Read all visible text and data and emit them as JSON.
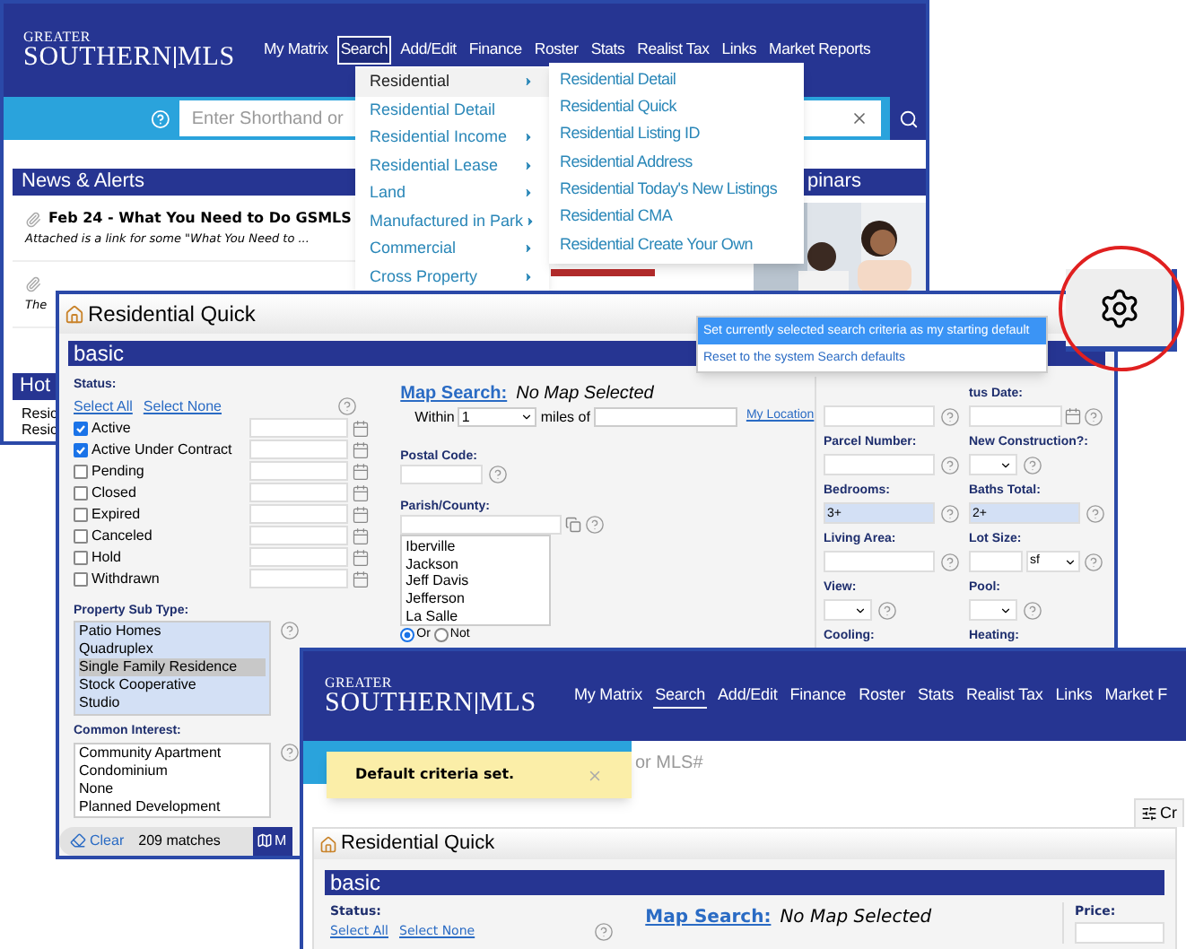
{
  "back_page": {
    "logo": {
      "top": "GREATER",
      "main": "SOUTHERN",
      "sub": "MLS"
    },
    "nav": [
      {
        "label": "My Matrix",
        "selected": false
      },
      {
        "label": "Search",
        "selected": true
      },
      {
        "label": "Add/Edit",
        "selected": false
      },
      {
        "label": "Finance",
        "selected": false
      },
      {
        "label": "Roster",
        "selected": false
      },
      {
        "label": "Stats",
        "selected": false
      },
      {
        "label": "Realist Tax",
        "selected": false
      },
      {
        "label": "Links",
        "selected": false
      },
      {
        "label": "Market Reports",
        "selected": false
      }
    ],
    "search_placeholder": "Enter Shorthand or",
    "menu": {
      "items": [
        {
          "label": "Residential",
          "selected": true,
          "submenu": true
        },
        {
          "label": "Residential Detail",
          "selected": false,
          "submenu": false
        },
        {
          "label": "Residential Income",
          "selected": false,
          "submenu": true
        },
        {
          "label": "Residential Lease",
          "selected": false,
          "submenu": true
        },
        {
          "label": "Land",
          "selected": false,
          "submenu": true
        },
        {
          "label": "Manufactured in Park",
          "selected": false,
          "submenu": true
        },
        {
          "label": "Commercial",
          "selected": false,
          "submenu": true
        },
        {
          "label": "Cross Property",
          "selected": false,
          "submenu": true
        }
      ],
      "submenu": [
        "Residential Detail",
        "Residential Quick",
        "Residential Listing ID",
        "Residential Address",
        "Residential Today's New Listings",
        "Residential CMA",
        "Residential Create Your Own"
      ]
    },
    "news": {
      "title": "News & Alerts",
      "items": [
        {
          "title": "Feb 24 - What You Need to Do GSMLS",
          "summary": "Attached is a link for some \"What You Need to ..."
        },
        {
          "summary": "The"
        }
      ]
    },
    "webinars_title": "pinars",
    "hot": {
      "title": "Hot",
      "items": [
        "Resic",
        "Resic"
      ]
    }
  },
  "search_window": {
    "title": "Residential Quick",
    "section": "basic",
    "status": {
      "label": "Status:",
      "select_all": "Select All",
      "select_none": "Select None",
      "options": [
        {
          "label": "Active",
          "checked": true
        },
        {
          "label": "Active Under Contract",
          "checked": true
        },
        {
          "label": "Pending",
          "checked": false
        },
        {
          "label": "Closed",
          "checked": false
        },
        {
          "label": "Expired",
          "checked": false
        },
        {
          "label": "Canceled",
          "checked": false
        },
        {
          "label": "Hold",
          "checked": false
        },
        {
          "label": "Withdrawn",
          "checked": false
        }
      ]
    },
    "property_sub_type": {
      "label": "Property Sub Type:",
      "options": [
        {
          "label": "Patio Homes",
          "selected": false
        },
        {
          "label": "Quadruplex",
          "selected": false
        },
        {
          "label": "Single Family Residence",
          "selected": true
        },
        {
          "label": "Stock Cooperative",
          "selected": false
        },
        {
          "label": "Studio",
          "selected": false
        }
      ]
    },
    "common_interest": {
      "label": "Common Interest:",
      "options": [
        "Community Apartment",
        "Condominium",
        "None",
        "Planned Development"
      ]
    },
    "map_search": {
      "label": "Map Search:",
      "value": "No Map Selected",
      "within": "Within",
      "distance": "1",
      "miles_of": "miles of",
      "my_location": "My Location"
    },
    "postal_code": {
      "label": "Postal Code:"
    },
    "parish": {
      "label": "Parish/County:",
      "options": [
        "Iberville",
        "Jackson",
        "Jeff Davis",
        "Jefferson",
        "La Salle"
      ],
      "modes": [
        {
          "label": "Or",
          "selected": true
        },
        {
          "label": "Not",
          "selected": false
        }
      ]
    },
    "fields": [
      {
        "kind": "text"
      },
      {
        "label": "tus Date:",
        "kind": "date"
      },
      {
        "label": "Parcel Number:",
        "kind": "text"
      },
      {
        "label": "New Construction?:",
        "kind": "select"
      },
      {
        "label": "Bedrooms:",
        "kind": "text",
        "value": "3+"
      },
      {
        "label": "Baths Total:",
        "kind": "text",
        "value": "2+"
      },
      {
        "label": "Living Area:",
        "kind": "text"
      },
      {
        "label": "Lot Size:",
        "kind": "unit",
        "unit": "sf"
      },
      {
        "label": "View:",
        "kind": "select"
      },
      {
        "label": "Pool:",
        "kind": "select"
      },
      {
        "label": "Cooling:",
        "kind": "none"
      },
      {
        "label": "Heating:",
        "kind": "none"
      }
    ],
    "settings_menu": [
      {
        "label": "Set currently selected search criteria as my starting default",
        "selected": true
      },
      {
        "label": "Reset to the system Search defaults",
        "selected": false
      }
    ],
    "footer": {
      "clear": "Clear",
      "matches": "209 matches",
      "map": "M"
    }
  },
  "front_page": {
    "logo": {
      "top": "GREATER",
      "main": "SOUTHERN",
      "sub": "MLS"
    },
    "nav": [
      {
        "label": "My Matrix",
        "selected": false
      },
      {
        "label": "Search",
        "selected": true
      },
      {
        "label": "Add/Edit",
        "selected": false
      },
      {
        "label": "Finance",
        "selected": false
      },
      {
        "label": "Roster",
        "selected": false
      },
      {
        "label": "Stats",
        "selected": false
      },
      {
        "label": "Realist Tax",
        "selected": false
      },
      {
        "label": "Links",
        "selected": false
      },
      {
        "label": "Market F",
        "selected": false
      }
    ],
    "search_placeholder": "or MLS#",
    "toast": "Default criteria set.",
    "criteria_button": "Cr",
    "title": "Residential Quick",
    "section": "basic",
    "status": {
      "label": "Status:",
      "select_all": "Select All",
      "select_none": "Select None"
    },
    "map_search": {
      "label": "Map Search:",
      "value": "No Map Selected"
    },
    "price_label": "Price:"
  }
}
